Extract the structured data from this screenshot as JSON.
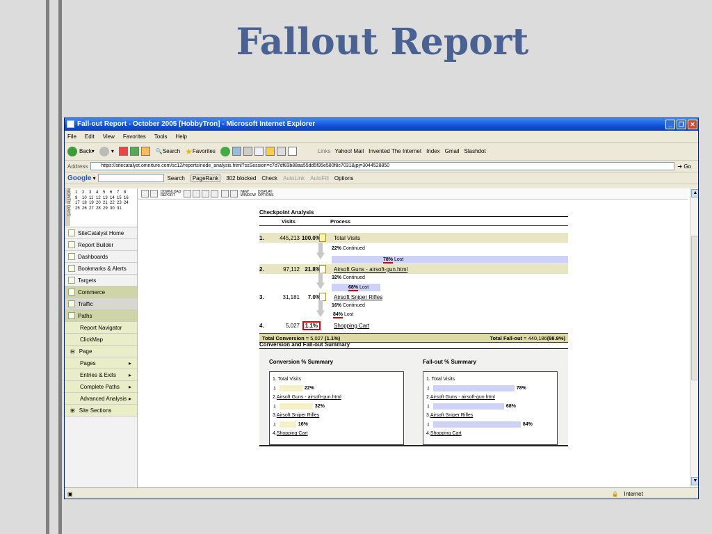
{
  "slide": {
    "title": "Fallout Report"
  },
  "window": {
    "title": "Fall-out Report - October 2005 [HobbyTron] - Microsoft Internet Explorer",
    "menu": [
      "File",
      "Edit",
      "View",
      "Favorites",
      "Tools",
      "Help"
    ],
    "toolbar": {
      "back": "Back",
      "search": "Search",
      "favorites": "Favorites",
      "links": "Links",
      "link_items": [
        "Yahoo! Mail",
        "Invented The Internet",
        "Index",
        "Gmail",
        "Slashdot"
      ]
    },
    "address": {
      "label": "Address",
      "url": "https://sitecatalyst.omniture.com/sc12/reports/node_analysis.html?ssSession=c7d7df83b88aa55dd5f95e580f8c7031&jpj=3044528850",
      "go": "Go"
    },
    "google": {
      "label": "Google",
      "search": "Search",
      "pagerank": "PageRank",
      "blocked": "302 blocked",
      "check": "Check",
      "autolink": "AutoLink",
      "autofill": "AutoFill",
      "options": "Options"
    },
    "status": {
      "zone": "Internet"
    }
  },
  "sidebar": {
    "calendar": {
      "month_tag": "MONTH",
      "days_tag": "DAYS",
      "days": [
        "1",
        "2",
        "3",
        "4",
        "5",
        "6",
        "7",
        "8",
        "9",
        "10",
        "11",
        "12",
        "13",
        "14",
        "15",
        "16",
        "17",
        "18",
        "19",
        "20",
        "21",
        "22",
        "23",
        "24",
        "25",
        "26",
        "27",
        "28",
        "29",
        "30",
        "31"
      ]
    },
    "items": [
      "SiteCatalyst Home",
      "Report Builder",
      "Dashboards",
      "Bookmarks & Alerts",
      "Targets",
      "Commerce",
      "Traffic",
      "Paths",
      "Report Navigator",
      "ClickMap",
      "Page",
      "Pages",
      "Entries & Exits",
      "Complete Paths",
      "Advanced Analysis",
      "Site Sections"
    ]
  },
  "topbar": {
    "download": "DOWNLOAD REPORT",
    "new_window": "NEW WINDOW",
    "display": "DISPLAY OPTIONS"
  },
  "checkpoint": {
    "title": "Checkpoint Analysis",
    "col_visits": "Visits",
    "col_process": "Process",
    "steps": [
      {
        "num": "1.",
        "visits": "445,213",
        "pct": "100.0%",
        "name": "Total Visits"
      },
      {
        "num": "2.",
        "visits": "97,112",
        "pct": "21.8%",
        "name": "Airsoft Guns - airsoft-gun.html"
      },
      {
        "num": "3.",
        "visits": "31,181",
        "pct": "7.0%",
        "name": "Airsoft Sniper Rifles"
      },
      {
        "num": "4.",
        "visits": "5,027",
        "pct": "1.1%",
        "name": "Shopping Cart"
      }
    ],
    "transitions": [
      {
        "continued": "22%",
        "lost": "78%"
      },
      {
        "continued": "32%",
        "lost": "68%"
      },
      {
        "continued": "16%",
        "lost": "84%"
      }
    ],
    "continued_label": "Continued",
    "lost_label": "Lost",
    "total_conversion_label": "Total Conversion",
    "total_conversion_value": "= 5,027",
    "total_conversion_pct": "(1.1%)",
    "total_fallout_label": "Total Fall-out",
    "total_fallout_value": "= 440,186",
    "total_fallout_pct": "(98.9%)"
  },
  "summary": {
    "title": "Conversion and Fall-out Summary",
    "conversion": {
      "title": "Conversion % Summary",
      "values": [
        22,
        32,
        16
      ],
      "labels": [
        "22%",
        "32%",
        "16%"
      ]
    },
    "fallout": {
      "title": "Fall-out % Summary",
      "values": [
        78,
        68,
        84
      ],
      "labels": [
        "78%",
        "68%",
        "84%"
      ]
    },
    "steps": [
      "1. Total Visits",
      "2. ",
      "Airsoft Guns - airsoft-gun.html",
      "3. ",
      "Airsoft Sniper Rifles",
      "4. ",
      "Shopping Cart"
    ]
  },
  "colors": {
    "title": "#4a6292",
    "band": "#e8e6c2",
    "lost": "#cdd2f6",
    "conv_bar": "#f5f0c6",
    "fall_bar": "#cdd2f6"
  }
}
